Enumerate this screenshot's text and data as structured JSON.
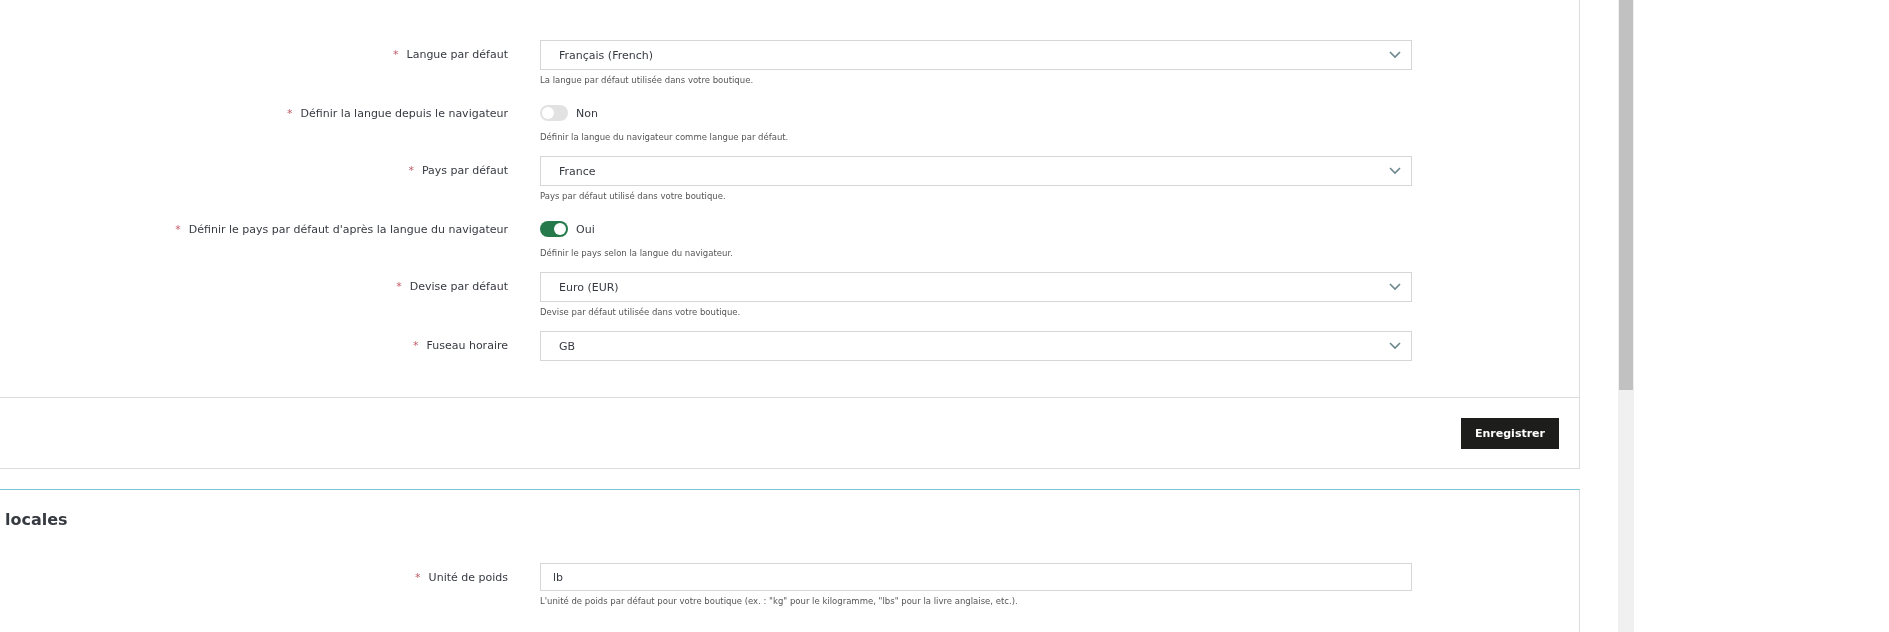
{
  "settings_card": {
    "fields": [
      {
        "kind": "select",
        "mark": "*",
        "label": "Langue par défaut",
        "value": "Français (French)",
        "help": "La langue par défaut utilisée dans votre boutique."
      },
      {
        "kind": "toggle",
        "mark": "*",
        "label": "Définir la langue depuis le navigateur",
        "on": false,
        "value": "Non",
        "help": "Définir la langue du navigateur comme langue par défaut."
      },
      {
        "kind": "select",
        "mark": "*",
        "label": "Pays par défaut",
        "value": "France",
        "help": "Pays par défaut utilisé dans votre boutique."
      },
      {
        "kind": "toggle",
        "mark": "*",
        "label": "Définir le pays par défaut d'après la langue du navigateur",
        "on": true,
        "value": "Oui",
        "help": "Définir le pays selon la langue du navigateur."
      },
      {
        "kind": "select",
        "mark": "*",
        "label": "Devise par défaut",
        "value": "Euro (EUR)",
        "help": "Devise par défaut utilisée dans votre boutique."
      },
      {
        "kind": "select",
        "mark": "*",
        "label": "Fuseau horaire",
        "value": "GB"
      }
    ],
    "save_button": "Enregistrer"
  },
  "units_card": {
    "title": "locales",
    "fields": [
      {
        "kind": "text",
        "mark": "*",
        "label": "Unité de poids",
        "value": "lb",
        "help": "L'unité de poids par défaut pour votre boutique (ex. : \"kg\" pour le kilogramme, \"lbs\" pour la livre anglaise, etc.)."
      }
    ]
  }
}
